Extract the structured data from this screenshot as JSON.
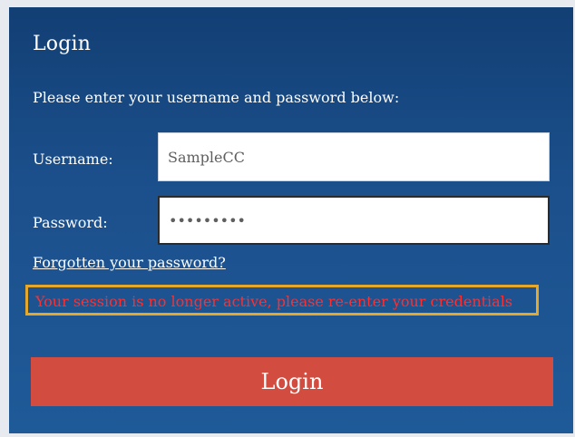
{
  "login": {
    "title": "Login",
    "instructions": "Please enter your username and password below:",
    "username_label": "Username:",
    "username_value": "SampleCC",
    "password_label": "Password:",
    "password_value": "•••••••••",
    "forgot_link": "Forgotten your password?",
    "error_message": "Your session is no longer active, please re-enter your credentials",
    "submit_label": "Login",
    "colors": {
      "panel_background": "#1b4f8b",
      "submit_background": "#d24d3f",
      "error_text": "#ff2f2f",
      "error_outline": "#e5a82b"
    }
  }
}
